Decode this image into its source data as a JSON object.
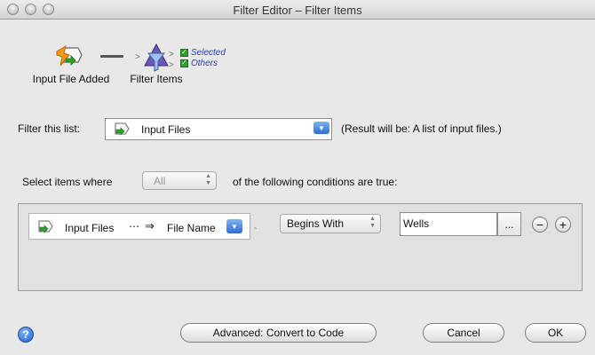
{
  "window": {
    "title": "Filter Editor – Filter Items"
  },
  "workflow": {
    "action1_label": "Input File Added",
    "action2_label": "Filter Items",
    "outputs": [
      "Selected",
      "Others"
    ]
  },
  "filter_list": {
    "label": "Filter this list:",
    "value": "Input Files",
    "result_text": "(Result will be: A list of input files.)"
  },
  "select_items": {
    "prefix": "Select items where",
    "quantifier": "All",
    "suffix": "of the following conditions are true:"
  },
  "condition": {
    "source": "Input Files",
    "ellipsis": "⋯",
    "arrow": "⇒",
    "property": "File Name",
    "operator": "Begins With",
    "value": "Wells",
    "more_label": "...",
    "remove_label": "−",
    "add_label": "+"
  },
  "buttons": {
    "help": "?",
    "advanced": "Advanced: Convert to Code",
    "cancel": "Cancel",
    "ok": "OK"
  },
  "colors": {
    "accent_blue": "#2f6cd5",
    "output_label": "#2a3fb0",
    "check_green": "#2e9e2e"
  }
}
